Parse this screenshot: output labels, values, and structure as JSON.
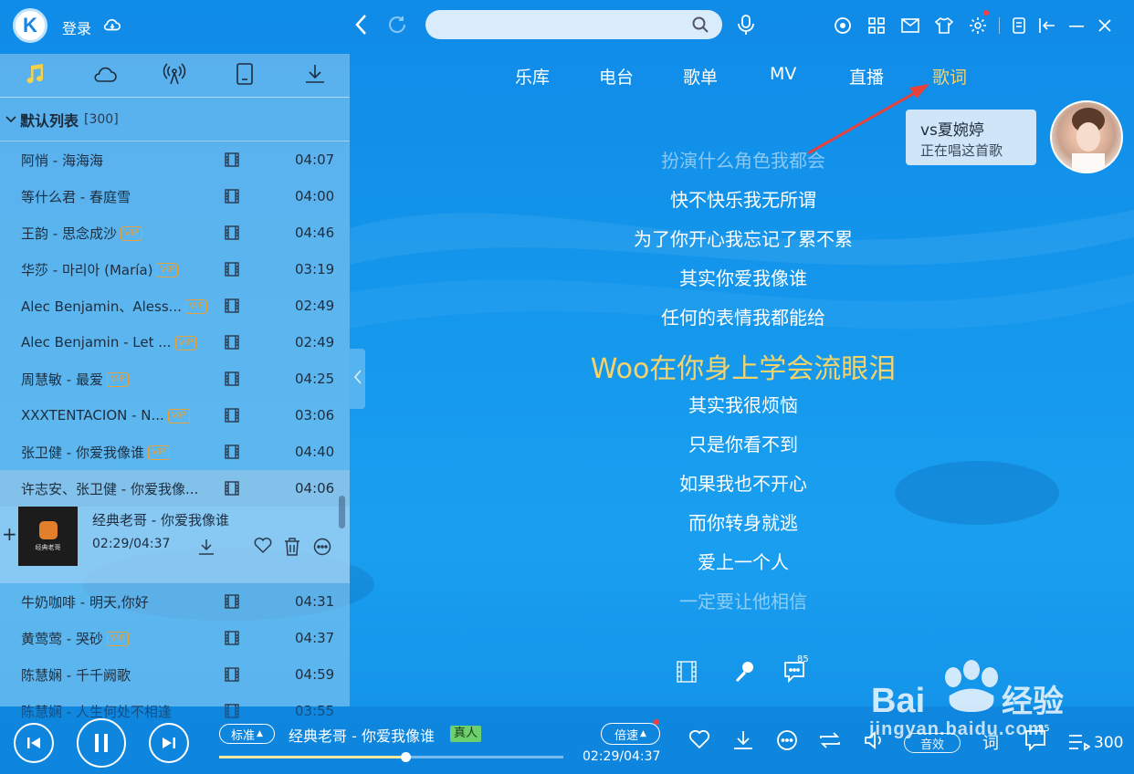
{
  "header": {
    "logo_letter": "K",
    "login_label": "登录",
    "search_placeholder": ""
  },
  "left_tabs": [
    "music-note-icon",
    "cloud-icon",
    "radio-icon",
    "device-icon",
    "download-icon"
  ],
  "playlist": {
    "title": "默认列表",
    "count": "[300]",
    "songs": [
      {
        "name": "阿悄 - 海海海",
        "vip": "",
        "duration": "04:07"
      },
      {
        "name": "等什么君 - 春庭雪",
        "vip": "",
        "duration": "04:00"
      },
      {
        "name": "王韵 - 思念成沙",
        "vip": "VIP",
        "duration": "04:46"
      },
      {
        "name": "华莎 - 마리아 (María)",
        "vip": "VIP",
        "duration": "03:19"
      },
      {
        "name": "Alec Benjamin、Aless...",
        "vip": "VIP",
        "duration": "02:49"
      },
      {
        "name": "Alec Benjamin - Let ...",
        "vip": "VIP",
        "duration": "02:49"
      },
      {
        "name": "周慧敏 - 最爱",
        "vip": "VIP",
        "duration": "04:25"
      },
      {
        "name": "XXXTENTACION - N...",
        "vip": "VIP",
        "duration": "03:06"
      },
      {
        "name": "张卫健 - 你爱我像谁",
        "vip": "VIP",
        "duration": "04:40"
      },
      {
        "name": "许志安、张卫健 - 你爱我像...",
        "vip": "",
        "duration": "04:06"
      }
    ],
    "playing": {
      "title": "经典老哥 - 你爱我像谁",
      "time": "02:29/04:37",
      "cover_text": "经典老哥"
    },
    "songs_after": [
      {
        "name": "牛奶咖啡 - 明天,你好",
        "vip": "",
        "duration": "04:31"
      },
      {
        "name": "黄莺莺 - 哭砂",
        "vip": "VIP",
        "duration": "04:37"
      },
      {
        "name": "陈慧娴 - 千千阙歌",
        "vip": "",
        "duration": "04:59"
      },
      {
        "name": "陈慧娴 - 人生何处不相逢",
        "vip": "",
        "duration": "03:55"
      }
    ]
  },
  "nav": {
    "tabs": [
      "乐库",
      "电台",
      "歌单",
      "MV",
      "直播",
      "歌词"
    ]
  },
  "singer_card": {
    "name": "vs夏婉婷",
    "subtitle": "正在唱这首歌"
  },
  "lyrics": {
    "lines": [
      "扮演什么角色我都会",
      "快不快乐我无所谓",
      "为了你开心我忘记了累不累",
      "其实你爱我像谁",
      "任何的表情我都能给",
      "Woo在你身上学会流眼泪",
      "其实我很烦恼",
      "只是你看不到",
      "如果我也不开心",
      "而你转身就逃",
      "爱上一个人",
      "一定要让他相信"
    ],
    "current_index": 5,
    "comment_count": "85"
  },
  "player": {
    "quality_label": "标准",
    "now_playing": "经典老哥 - 你爱我像谁",
    "real_badge": "真人",
    "speed_label": "倍速",
    "time": "02:29/04:37",
    "progress": 0.54,
    "sound_label": "音效",
    "lyric_label": "词",
    "comment_count": "85",
    "list_count": "300"
  },
  "watermark": {
    "text": "jingyan.baidu.com",
    "brand": "Bai 经验"
  },
  "colors": {
    "accent": "#1685e5",
    "current_lyric": "#f4d36b",
    "vip": "#e6a13a",
    "real_badge": "#6cd06d"
  }
}
